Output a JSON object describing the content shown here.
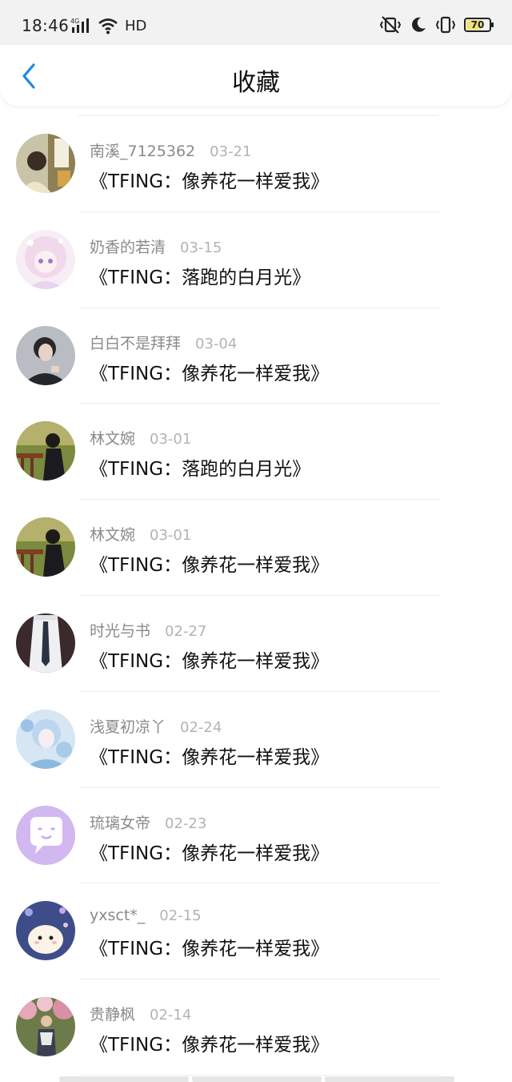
{
  "status_bar": {
    "time": "18:46",
    "network": "4G",
    "hd": "HD",
    "battery": "70",
    "battery_level": 0.7,
    "icons": [
      "signal-icon",
      "wifi-icon",
      "vibrate-off-icon",
      "moon-icon",
      "vibrate-icon",
      "battery-icon"
    ]
  },
  "header": {
    "title": "收藏",
    "back_icon": "chevron-left-icon",
    "accent": "#1e88e5"
  },
  "favorites": [
    {
      "user": "南溪_7125362",
      "date": "03-21",
      "work": "《TFING：像养花一样爱我》"
    },
    {
      "user": "奶香的若清",
      "date": "03-15",
      "work": "《TFING：落跑的白月光》"
    },
    {
      "user": "白白不是拜拜",
      "date": "03-04",
      "work": "《TFING：像养花一样爱我》"
    },
    {
      "user": "林文婉",
      "date": "03-01",
      "work": "《TFING：落跑的白月光》"
    },
    {
      "user": "林文婉",
      "date": "03-01",
      "work": "《TFING：像养花一样爱我》"
    },
    {
      "user": "时光与书",
      "date": "02-27",
      "work": "《TFING：像养花一样爱我》"
    },
    {
      "user": "浅夏初凉丫",
      "date": "02-24",
      "work": "《TFING：像养花一样爱我》"
    },
    {
      "user": "琉璃女帝",
      "date": "02-23",
      "work": "《TFING：像养花一样爱我》"
    },
    {
      "user": "yxsct*_",
      "date": "02-15",
      "work": "《TFING：像养花一样爱我》"
    },
    {
      "user": "贵静枫",
      "date": "02-14",
      "work": "《TFING：像养花一样爱我》"
    }
  ]
}
